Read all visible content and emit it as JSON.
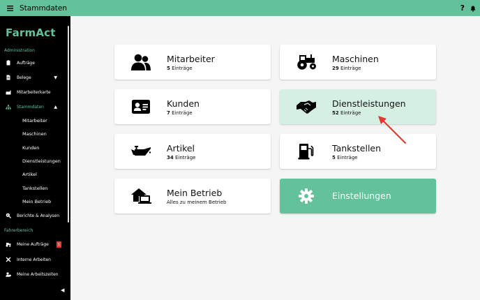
{
  "topbar": {
    "title": "Stammdaten",
    "help": "?"
  },
  "sidebar": {
    "logo": "FarmAct",
    "section_admin": "Administration",
    "section_driver": "Fahrerbereich",
    "items": {
      "auftraege": "Aufträge",
      "belege": "Belege",
      "mitarbeiterkarte": "Mitarbeiterkarte",
      "stammdaten": "Stammdaten",
      "berichte": "Berichte & Analysen",
      "meine_auftraege": "Meine Aufträge",
      "interne_arbeiten": "Interne Arbeiten",
      "meine_arbeitszeiten": "Meine Arbeitszeiten"
    },
    "sub_items": [
      "Mitarbeiter",
      "Maschinen",
      "Kunden",
      "Dienstleistungen",
      "Artikel",
      "Tankstellen",
      "Mein Betrieb"
    ],
    "badge": "1"
  },
  "cards": {
    "mitarbeiter": {
      "title": "Mitarbeiter",
      "count": "5",
      "suffix": "Einträge"
    },
    "maschinen": {
      "title": "Maschinen",
      "count": "29",
      "suffix": "Einträge"
    },
    "kunden": {
      "title": "Kunden",
      "count": "7",
      "suffix": "Einträge"
    },
    "dienstleistungen": {
      "title": "Dienstleistungen",
      "count": "52",
      "suffix": "Einträge"
    },
    "artikel": {
      "title": "Artikel",
      "count": "34",
      "suffix": "Einträge"
    },
    "tankstellen": {
      "title": "Tankstellen",
      "count": "5",
      "suffix": "Einträge"
    },
    "mein_betrieb": {
      "title": "Mein Betrieb",
      "subtitle": "Alles zu meinem Betrieb"
    },
    "einstellungen": {
      "title": "Einstellungen"
    }
  },
  "colors": {
    "accent": "#63c29c",
    "highlight": "#d6efe5",
    "arrow": "#e53935"
  }
}
